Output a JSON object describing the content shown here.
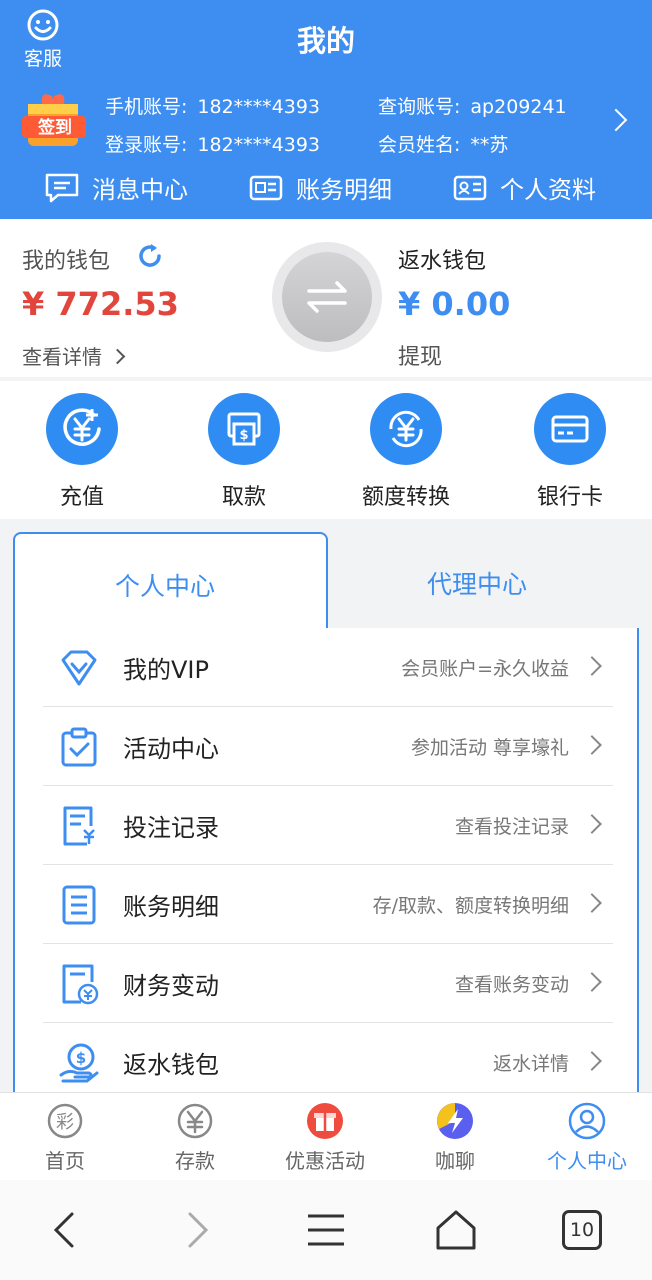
{
  "header": {
    "service_label": "客服",
    "title": "我的",
    "sign_badge": "签到",
    "phone_label": "手机账号:",
    "phone_value": "182****4393",
    "login_label": "登录账号:",
    "login_value": "182****4393",
    "query_label": "查询账号:",
    "query_value": "ap209241",
    "name_label": "会员姓名:",
    "name_value": "**苏",
    "nav": [
      "消息中心",
      "账务明细",
      "个人资料"
    ]
  },
  "wallet": {
    "my_label": "我的钱包",
    "my_amount": "¥ 772.53",
    "my_link": "查看详情",
    "rebate_label": "返水钱包",
    "rebate_amount": "¥ 0.00",
    "rebate_link": "提现"
  },
  "actions": [
    "充值",
    "取款",
    "额度转换",
    "银行卡"
  ],
  "tabs": {
    "personal": "个人中心",
    "agent": "代理中心"
  },
  "menu": [
    {
      "label": "我的VIP",
      "hint": "会员账户=永久收益",
      "icon": "diamond-icon"
    },
    {
      "label": "活动中心",
      "hint": "参加活动 尊享壕礼",
      "icon": "clipboard-check-icon"
    },
    {
      "label": "投注记录",
      "hint": "查看投注记录",
      "icon": "bet-record-icon"
    },
    {
      "label": "账务明细",
      "hint": "存/取款、额度转换明细",
      "icon": "ledger-icon"
    },
    {
      "label": "财务变动",
      "hint": "查看账务变动",
      "icon": "finance-icon"
    },
    {
      "label": "返水钱包",
      "hint": "返水详情",
      "icon": "rebate-icon"
    }
  ],
  "tabbar": [
    "首页",
    "存款",
    "优惠活动",
    "咖聊",
    "个人中心"
  ],
  "tabbar_active": "个人中心",
  "system": {
    "tab_count": "10"
  },
  "colors": {
    "primary": "#3d8ef0",
    "amount_red": "#e2453c",
    "amount_blue": "#3d8ef0"
  }
}
